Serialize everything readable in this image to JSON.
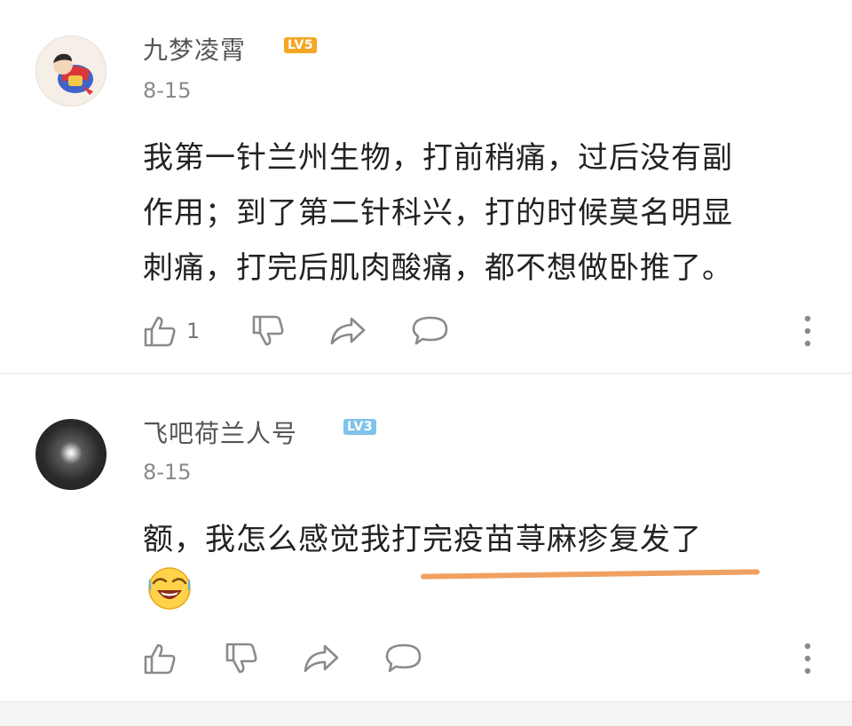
{
  "comments": [
    {
      "username": "九梦凌霄",
      "level": "LV5",
      "date": "8-15",
      "lines": [
        "我第一针兰州生物，打前稍痛，过后没有副",
        "作用；到了第二针科兴，打的时候莫名明显",
        "刺痛，打完后肌肉酸痛，都不想做卧推了。"
      ],
      "like_count": "1"
    },
    {
      "username": "飞吧荷兰人号",
      "level": "LV3",
      "date": "8-15",
      "lines": [
        "额，我怎么感觉我打完疫苗荨麻疹复发了"
      ],
      "like_count": ""
    }
  ],
  "colors": {
    "lv5_badge": "#f5a623",
    "lv3_badge": "#7fc3ea",
    "highlight_underline": "#f0a060"
  },
  "icons": [
    "like-icon",
    "dislike-icon",
    "share-icon",
    "reply-icon",
    "more-icon",
    "laugh-cry-emoji"
  ]
}
